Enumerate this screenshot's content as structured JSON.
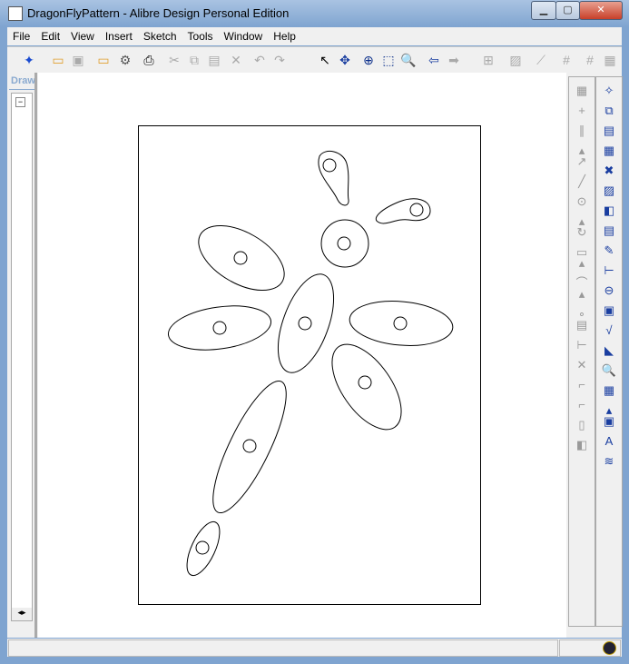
{
  "window": {
    "title": "DragonFlyPattern - Alibre Design Personal Edition",
    "minimize": "▁",
    "maximize": "▢",
    "close": "✕"
  },
  "menu": [
    "File",
    "Edit",
    "View",
    "Insert",
    "Sketch",
    "Tools",
    "Window",
    "Help"
  ],
  "toolbar": [
    {
      "icon": "new-icon",
      "glyph": "✦",
      "enabled": true
    },
    {
      "icon": "open-icon",
      "glyph": "▭",
      "enabled": true
    },
    {
      "icon": "save-icon",
      "glyph": "▣",
      "enabled": false
    },
    {
      "icon": "open-workspace-icon",
      "glyph": "▭",
      "enabled": true
    },
    {
      "icon": "save-workspace-icon",
      "glyph": "⚙",
      "enabled": true
    },
    {
      "icon": "print-icon",
      "glyph": "⎙",
      "enabled": true
    },
    {
      "icon": "cut-icon",
      "glyph": "✂",
      "enabled": false
    },
    {
      "icon": "copy-icon",
      "glyph": "⧉",
      "enabled": false
    },
    {
      "icon": "paste-icon",
      "glyph": "▤",
      "enabled": false
    },
    {
      "icon": "delete-icon",
      "glyph": "✕",
      "enabled": false
    },
    {
      "icon": "undo-icon",
      "glyph": "↶",
      "enabled": false
    },
    {
      "icon": "redo-icon",
      "glyph": "↷",
      "enabled": false
    },
    {
      "icon": "select-icon",
      "glyph": "↖",
      "enabled": true
    },
    {
      "icon": "pan-icon",
      "glyph": "✥",
      "enabled": true
    },
    {
      "icon": "zoom-in-icon",
      "glyph": "⊕",
      "enabled": true
    },
    {
      "icon": "zoom-window-icon",
      "glyph": "⬚",
      "enabled": true
    },
    {
      "icon": "zoom-fit-icon",
      "glyph": "🔍",
      "enabled": true
    },
    {
      "icon": "back-icon",
      "glyph": "⇦",
      "enabled": true
    },
    {
      "icon": "forward-icon",
      "glyph": "➡",
      "enabled": false
    },
    {
      "icon": "constraints-icon",
      "glyph": "⊞",
      "enabled": false
    },
    {
      "icon": "fix-icon",
      "glyph": "▨",
      "enabled": false
    },
    {
      "icon": "dimension-icon",
      "glyph": "⟋",
      "enabled": false
    },
    {
      "icon": "grid-icon",
      "glyph": "#",
      "enabled": false
    },
    {
      "icon": "snap-grid-icon",
      "glyph": "#",
      "enabled": false
    },
    {
      "icon": "grid-settings-icon",
      "glyph": "▦",
      "enabled": false
    }
  ],
  "left_panel": {
    "header": "Drawing",
    "collapse": "−",
    "scroll_left": "◂",
    "scroll_right": "▸"
  },
  "sketch_tools": [
    "grid-icon",
    "plus-icon",
    "parallel-icon",
    "chevron-icon",
    "dimension-icon",
    "line-icon",
    "circle-icon",
    "chevron-icon",
    "arc-icon",
    "chevron-icon",
    "rectangle-icon",
    "chevron-icon",
    "spline-icon",
    "chevron-icon",
    "point-icon",
    "text-icon",
    "linear-dim-icon",
    "intersect-icon",
    "fillet-icon",
    "chamfer-icon",
    "hole-icon",
    "mirror-icon"
  ],
  "sketch_glyphs": [
    "▦",
    "+",
    "∥",
    "▴",
    "↗",
    "╱",
    "⊙",
    "▴",
    "↻",
    "▭",
    "▴",
    "⌒",
    "▴",
    "∘",
    "▤",
    "⊢",
    "✕",
    "⌐",
    "⌐",
    "▯",
    "◧"
  ],
  "drawing_tools": [
    "new-sheet-icon",
    "sheets-icon",
    "properties-icon",
    "standard-view-icon",
    "view-icon",
    "section-icon",
    "detail-icon",
    "note-icon",
    "edit-icon",
    "datum-icon",
    "center-mark-icon",
    "balloon-icon",
    "surface-finish-icon",
    "weld-icon",
    "zoom-icon",
    "table-icon",
    "chevron-icon",
    "bom-icon",
    "text-style-icon",
    "layers-icon"
  ],
  "drawing_glyphs": [
    "✧",
    "⧉",
    "▤",
    "▦",
    "✖",
    "▨",
    "◧",
    "▤",
    "✎",
    "⊢",
    "⊖",
    "▣",
    "√",
    "◣",
    "🔍",
    "▦",
    "▴",
    "▣",
    "A",
    "≋"
  ],
  "status": {
    "text": ""
  }
}
